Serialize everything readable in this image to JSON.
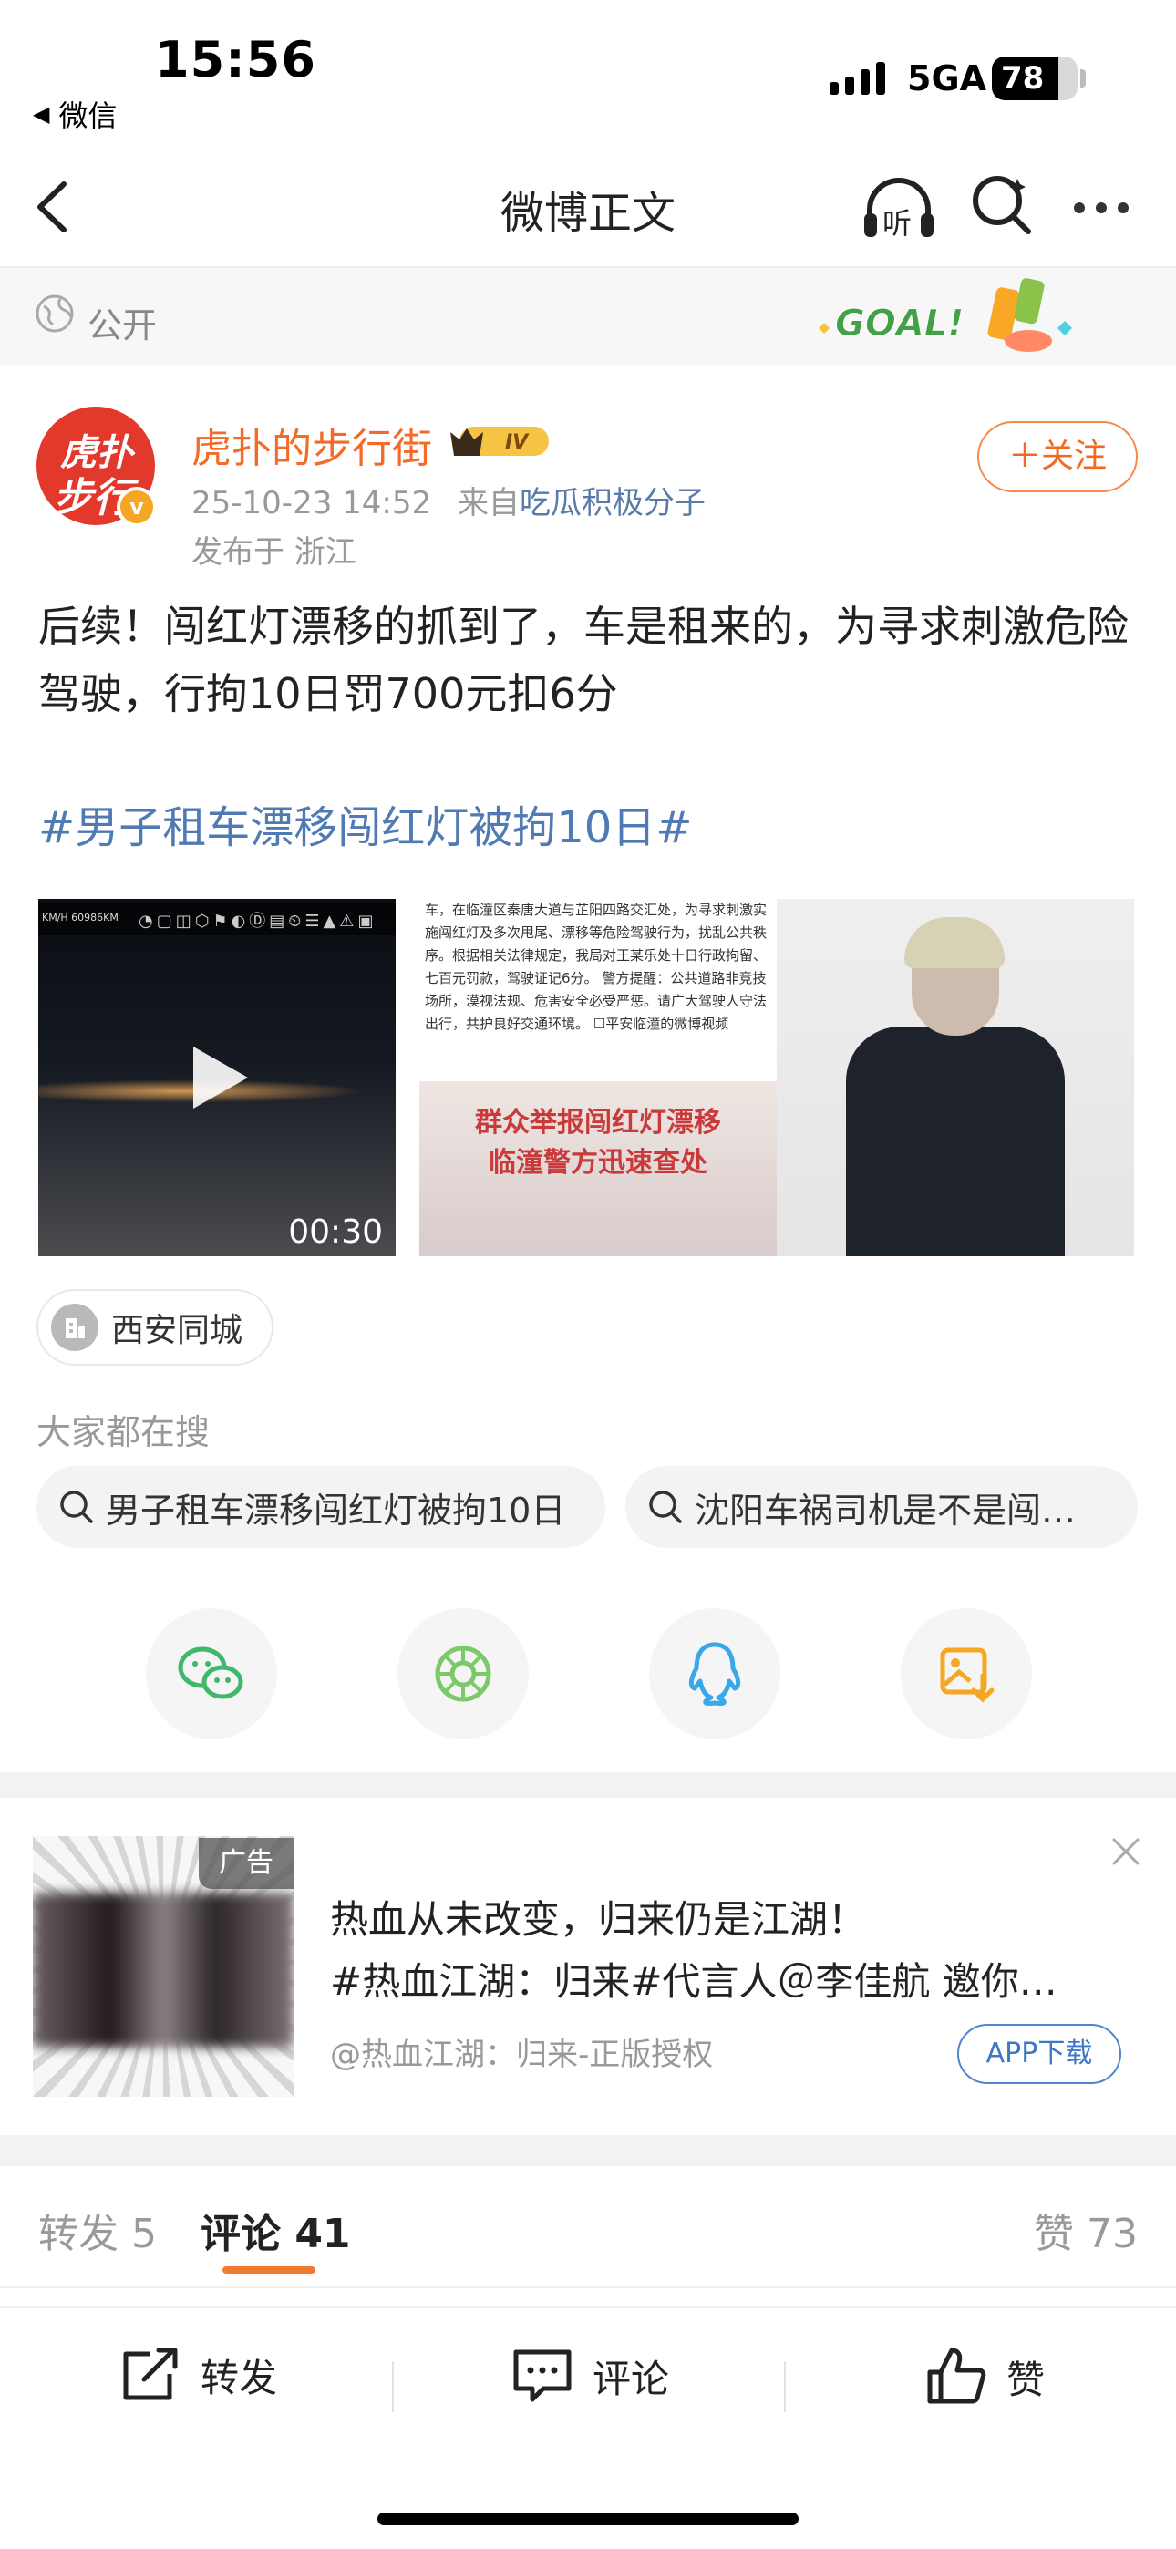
{
  "status_bar": {
    "time": "15:56",
    "back_app": "微信",
    "network": "5GA",
    "battery": "78",
    "battery_fraction": 0.78
  },
  "nav": {
    "title": "微博正文",
    "listen_label": "听",
    "icons": [
      "back-chevron-icon",
      "listen-headphones-icon",
      "search-icon",
      "more-icon"
    ]
  },
  "visibility": {
    "label": "公开",
    "badge_text": "GOAL!"
  },
  "author": {
    "name": "虎扑的步行街",
    "avatar_line1": "虎扑",
    "avatar_line2": "步行街",
    "verified_mark": "v",
    "level": "IV",
    "timestamp": "25-10-23 14:52",
    "source_prefix": "来自",
    "source": "吃瓜积极分子",
    "location": "发布于 浙江",
    "follow_label": "＋关注"
  },
  "post": {
    "text": "后续！闯红灯漂移的抓到了，车是租来的，为寻求刺激危险驾驶，行拘10日罚700元扣6分",
    "topic": "#男子租车漂移闯红灯被拘10日#"
  },
  "media": {
    "video_hud": "KM/H 60986KM",
    "video_duration": "00:30",
    "image2_text": "车，在临潼区秦唐大道与芷阳四路交汇处，为寻求刺激实施闯红灯及多次甩尾、漂移等危险驾驶行为，扰乱公共秩序。根据相关法律规定，我局对王某乐处十日行政拘留、七百元罚款，驾驶证记6分。 警方提醒：公共道路非竞技场所，漠视法规、危害安全必受严惩。请广大驾驶人守法出行，共护良好交通环境。 ☐平安临潼的微博视频",
    "image2_banner_l1": "群众举报闯红灯漂移",
    "image2_banner_l2": "临潼警方迅速查处"
  },
  "location_chip": "西安同城",
  "search": {
    "label": "大家都在搜",
    "items": [
      "男子租车漂移闯红灯被拘10日",
      "沈阳车祸司机是不是闯…"
    ]
  },
  "share": [
    "wechat-icon",
    "moments-icon",
    "qq-icon",
    "save-image-icon"
  ],
  "ad": {
    "tag": "广告",
    "line1": "热血从未改变，归来仍是江湖！",
    "line2": "#热血江湖：归来#代言人＠李佳航 邀你…",
    "sponsor": "@热血江湖：归来-正版授权",
    "button": "APP下载"
  },
  "tabs": {
    "repost": "转发 5",
    "comment": "评论 41",
    "like": "赞 73"
  },
  "toolbar": {
    "repost": "转发",
    "comment": "评论",
    "like": "赞"
  },
  "colors": {
    "accent_orange": "#f46a28",
    "link_blue": "#4f7ab3",
    "muted": "#999999"
  }
}
